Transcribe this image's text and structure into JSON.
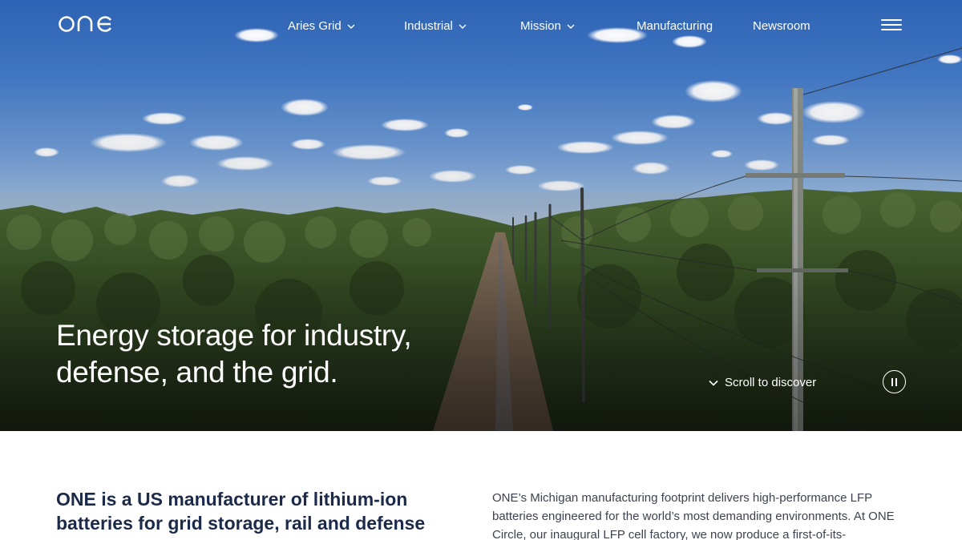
{
  "brand": {
    "logo_text": "one"
  },
  "nav": {
    "items": [
      {
        "label": "Aries Grid",
        "has_dropdown": true
      },
      {
        "label": "Industrial",
        "has_dropdown": true
      },
      {
        "label": "Mission",
        "has_dropdown": true
      },
      {
        "label": "Manufacturing",
        "has_dropdown": false
      },
      {
        "label": "Newsroom",
        "has_dropdown": false
      }
    ],
    "menu_icon": "hamburger-icon"
  },
  "hero": {
    "title": "Energy storage for industry, defense, and the grid.",
    "scroll_label": "Scroll to discover",
    "scroll_icon": "chevron-down-icon",
    "pause_icon": "pause-icon",
    "image": "aerial view of forest with dirt road and power line poles under blue sky with clouds"
  },
  "intro": {
    "heading": "ONE is a US manufacturer of lithium-ion batteries for grid storage, rail and defense",
    "body": "ONE’s Michigan manufacturing footprint delivers high-performance LFP batteries engineered for the world’s most demanding environments. At ONE Circle, our inaugural LFP cell factory, we now produce a first-of-its-"
  },
  "colors": {
    "sky_top": "#2d63b4",
    "forest": "#2e4a22",
    "text_dark": "#1c2a4a",
    "text_body": "#3d4250",
    "white": "#ffffff"
  }
}
